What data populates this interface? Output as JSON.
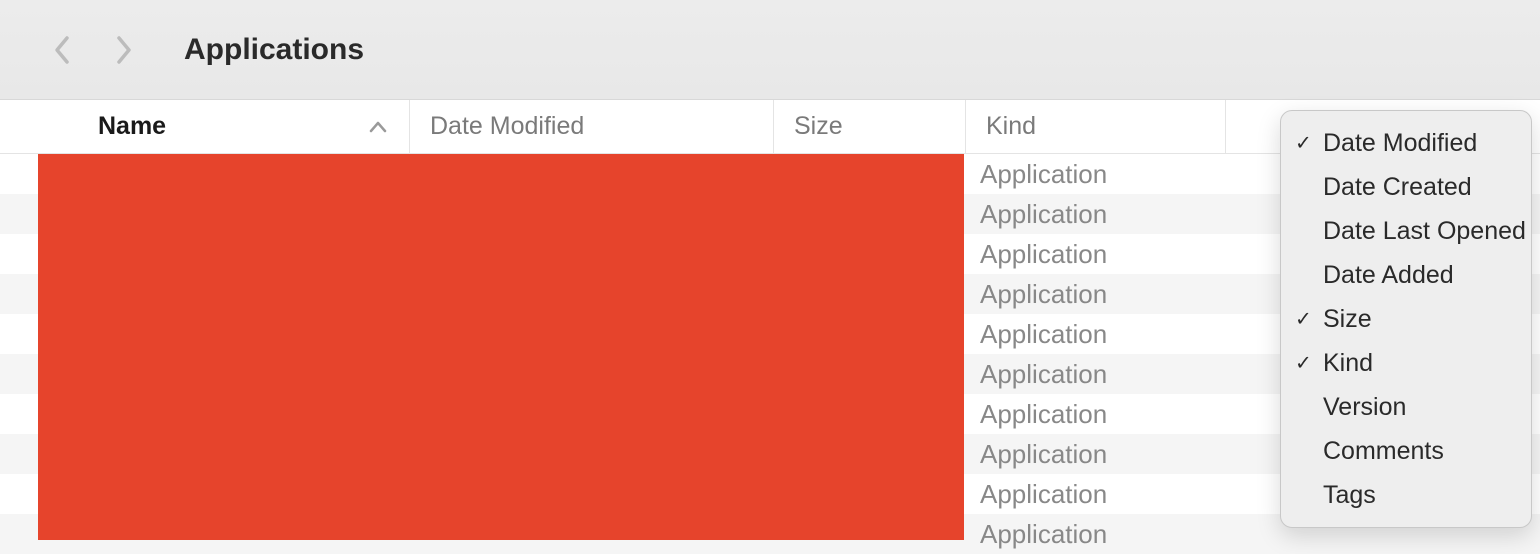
{
  "toolbar": {
    "title": "Applications"
  },
  "columns": {
    "name": "Name",
    "date_modified": "Date Modified",
    "size": "Size",
    "kind": "Kind"
  },
  "rows": [
    {
      "kind": "Application"
    },
    {
      "kind": "Application"
    },
    {
      "kind": "Application"
    },
    {
      "kind": "Application"
    },
    {
      "kind": "Application"
    },
    {
      "kind": "Application"
    },
    {
      "kind": "Application"
    },
    {
      "kind": "Application"
    },
    {
      "kind": "Application"
    },
    {
      "kind": "Application"
    }
  ],
  "context_menu": {
    "items": [
      {
        "label": "Date Modified",
        "checked": true
      },
      {
        "label": "Date Created",
        "checked": false
      },
      {
        "label": "Date Last Opened",
        "checked": false
      },
      {
        "label": "Date Added",
        "checked": false
      },
      {
        "label": "Size",
        "checked": true
      },
      {
        "label": "Kind",
        "checked": true
      },
      {
        "label": "Version",
        "checked": false
      },
      {
        "label": "Comments",
        "checked": false
      },
      {
        "label": "Tags",
        "checked": false
      }
    ]
  }
}
